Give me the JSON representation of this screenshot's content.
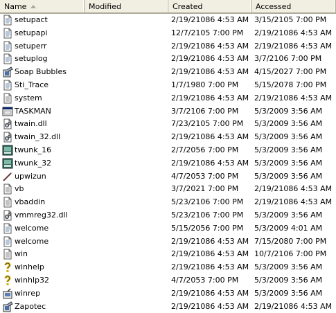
{
  "columns": {
    "name": "Name",
    "modified": "Modified",
    "created": "Created",
    "accessed": "Accessed"
  },
  "files": [
    {
      "name": "setupact",
      "icon": "text-file-icon",
      "modified": "",
      "created": "2/19/21086 4:53 AM",
      "accessed": "3/15/2105 7:00 PM"
    },
    {
      "name": "setupapi",
      "icon": "text-file-icon",
      "modified": "",
      "created": "12/7/2105 7:00 PM",
      "accessed": "2/19/21086 4:53 AM"
    },
    {
      "name": "setuperr",
      "icon": "text-file-icon",
      "modified": "",
      "created": "2/19/21086 4:53 AM",
      "accessed": "2/19/21086 4:53 AM"
    },
    {
      "name": "setuplog",
      "icon": "text-file-icon",
      "modified": "",
      "created": "2/19/21086 4:53 AM",
      "accessed": "3/7/2106 7:00 PM"
    },
    {
      "name": "Soap Bubbles",
      "icon": "image-file-icon",
      "modified": "",
      "created": "2/19/21086 4:53 AM",
      "accessed": "4/15/2027 7:00 PM"
    },
    {
      "name": "Sti_Trace",
      "icon": "text-file-icon",
      "modified": "",
      "created": "1/7/1980 7:00 PM",
      "accessed": "5/15/2078 7:00 PM"
    },
    {
      "name": "system",
      "icon": "config-file-icon",
      "modified": "",
      "created": "2/19/21086 4:53 AM",
      "accessed": "2/19/21086 4:53 AM"
    },
    {
      "name": "TASKMAN",
      "icon": "application-icon",
      "modified": "",
      "created": "3/7/2106 7:00 PM",
      "accessed": "5/3/2009 3:56 AM"
    },
    {
      "name": "twain.dll",
      "icon": "dll-file-icon",
      "modified": "",
      "created": "7/23/2105 7:00 PM",
      "accessed": "5/3/2009 3:56 AM"
    },
    {
      "name": "twain_32.dll",
      "icon": "dll-file-icon",
      "modified": "",
      "created": "2/19/21086 4:53 AM",
      "accessed": "5/3/2009 3:56 AM"
    },
    {
      "name": "twunk_16",
      "icon": "scanner-app-icon",
      "modified": "",
      "created": "2/7/2056 7:00 PM",
      "accessed": "5/3/2009 3:56 AM"
    },
    {
      "name": "twunk_32",
      "icon": "scanner-app-icon",
      "modified": "",
      "created": "2/19/21086 4:53 AM",
      "accessed": "5/3/2009 3:56 AM"
    },
    {
      "name": "upwizun",
      "icon": "wand-icon",
      "modified": "",
      "created": "4/7/2053 7:00 PM",
      "accessed": "5/3/2009 3:56 AM"
    },
    {
      "name": "vb",
      "icon": "config-file-icon",
      "modified": "",
      "created": "3/7/2021 7:00 PM",
      "accessed": "2/19/21086 4:53 AM"
    },
    {
      "name": "vbaddin",
      "icon": "config-file-icon",
      "modified": "",
      "created": "5/23/2106 7:00 PM",
      "accessed": "2/19/21086 4:53 AM"
    },
    {
      "name": "vmmreg32.dll",
      "icon": "dll-file-icon",
      "modified": "",
      "created": "5/23/2106 7:00 PM",
      "accessed": "5/3/2009 3:56 AM"
    },
    {
      "name": "welcome",
      "icon": "text-file-icon",
      "modified": "",
      "created": "5/15/2056 7:00 PM",
      "accessed": "5/3/2009 4:01 AM"
    },
    {
      "name": "welcome",
      "icon": "text-file-icon",
      "modified": "",
      "created": "2/19/21086 4:53 AM",
      "accessed": "7/15/2080 7:00 PM"
    },
    {
      "name": "win",
      "icon": "config-file-icon",
      "modified": "",
      "created": "2/19/21086 4:53 AM",
      "accessed": "10/7/2106 7:00 PM"
    },
    {
      "name": "winhelp",
      "icon": "help-icon",
      "modified": "",
      "created": "2/19/21086 4:53 AM",
      "accessed": "5/3/2009 3:56 AM"
    },
    {
      "name": "winhlp32",
      "icon": "help-icon",
      "modified": "",
      "created": "4/7/2053 7:00 PM",
      "accessed": "5/3/2009 3:56 AM"
    },
    {
      "name": "winrep",
      "icon": "winrep-app-icon",
      "modified": "",
      "created": "2/19/21086 4:53 AM",
      "accessed": "5/3/2009 3:56 AM"
    },
    {
      "name": "Zapotec",
      "icon": "image-file-icon",
      "modified": "",
      "created": "2/19/21086 4:53 AM",
      "accessed": "2/19/21086 4:53 AM"
    }
  ]
}
